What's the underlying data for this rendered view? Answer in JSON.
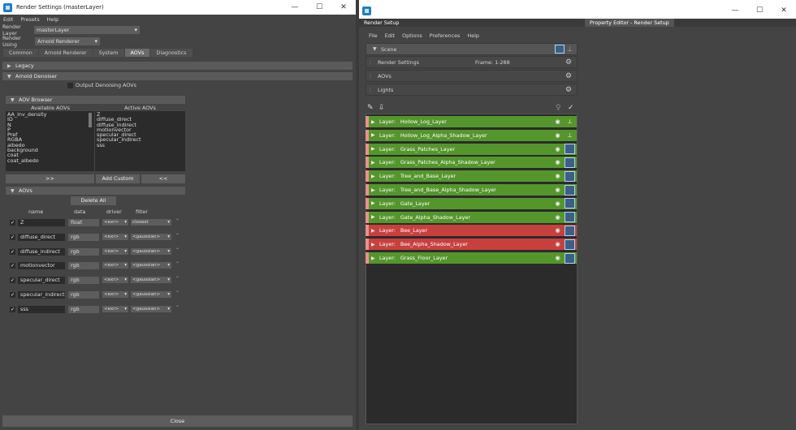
{
  "left_window": {
    "title": "Render Settings (masterLayer)",
    "menu": [
      "Edit",
      "Presets",
      "Help"
    ],
    "render_layer_label": "Render Layer",
    "render_layer_value": "masterLayer",
    "render_using_label": "Render Using",
    "render_using_value": "Arnold Renderer",
    "tabs": [
      "Common",
      "Arnold Renderer",
      "System",
      "AOVs",
      "Diagnostics"
    ],
    "legacy": "Legacy",
    "arnold_denoiser": "Arnold Denoiser",
    "output_denoising": "Output Denoising AOVs",
    "aov_browser": "AOV Browser",
    "available_header": "Available AOVs",
    "active_header": "Active AOVs",
    "available": [
      "AA_inv_density",
      "ID",
      "N",
      "P",
      "Pref",
      "RGBA",
      "albedo",
      "background",
      "coat",
      "coat_albedo"
    ],
    "active": [
      "Z",
      "diffuse_direct",
      "diffuse_indirect",
      "motionvector",
      "specular_direct",
      "specular_indirect",
      "sss"
    ],
    "btn_add": ">>",
    "btn_add_custom": "Add Custom",
    "btn_remove": "<<",
    "aovs_section": "AOVs",
    "delete_all": "Delete All",
    "col_name": "name",
    "col_data": "data",
    "col_driver": "driver",
    "col_filter": "filter",
    "rows": [
      {
        "name": "Z",
        "data": "float",
        "driver": "<exr>",
        "filter": "closest"
      },
      {
        "name": "diffuse_direct",
        "data": "rgb",
        "driver": "<exr>",
        "filter": "<gaussian>"
      },
      {
        "name": "diffuse_indirect",
        "data": "rgb",
        "driver": "<exr>",
        "filter": "<gaussian>"
      },
      {
        "name": "motionvector",
        "data": "rgb",
        "driver": "<exr>",
        "filter": "<gaussian>"
      },
      {
        "name": "specular_direct",
        "data": "rgb",
        "driver": "<exr>",
        "filter": "<gaussian>"
      },
      {
        "name": "specular_indirect",
        "data": "rgb",
        "driver": "<exr>",
        "filter": "<gaussian>"
      },
      {
        "name": "sss",
        "data": "rgb",
        "driver": "<exr>",
        "filter": "<gaussian>"
      }
    ],
    "close": "Close"
  },
  "right_window": {
    "tab_render_setup": "Render Setup",
    "tab_property_editor": "Property Editor - Render Setup",
    "menu": [
      "File",
      "Edit",
      "Options",
      "Preferences",
      "Help"
    ],
    "scene": "Scene",
    "render_settings": "Render Settings",
    "frame": "Frame: 1-288",
    "aovs": "AOVs",
    "lights": "Lights",
    "layer_prefix": "Layer:",
    "layers": [
      {
        "name": "Hollow_Log_Layer",
        "status": "green"
      },
      {
        "name": "Hollow_Log_Alpha_Shadow_Layer",
        "status": "green"
      },
      {
        "name": "Grass_Patches_Layer",
        "status": "green"
      },
      {
        "name": "Grass_Patches_Alpha_Shadow_Layer",
        "status": "green"
      },
      {
        "name": "Tree_and_Base_Layer",
        "status": "green"
      },
      {
        "name": "Tree_and_Base_Alpha_Shadow_Layer",
        "status": "green"
      },
      {
        "name": "Gate_Layer",
        "status": "green"
      },
      {
        "name": "Gate_Alpha_Shadow_Layer",
        "status": "green"
      },
      {
        "name": "Bee_Layer",
        "status": "red"
      },
      {
        "name": "Bee_Alpha_Shadow_Layer",
        "status": "red"
      },
      {
        "name": "Grass_Floor_Layer",
        "status": "green"
      }
    ]
  }
}
